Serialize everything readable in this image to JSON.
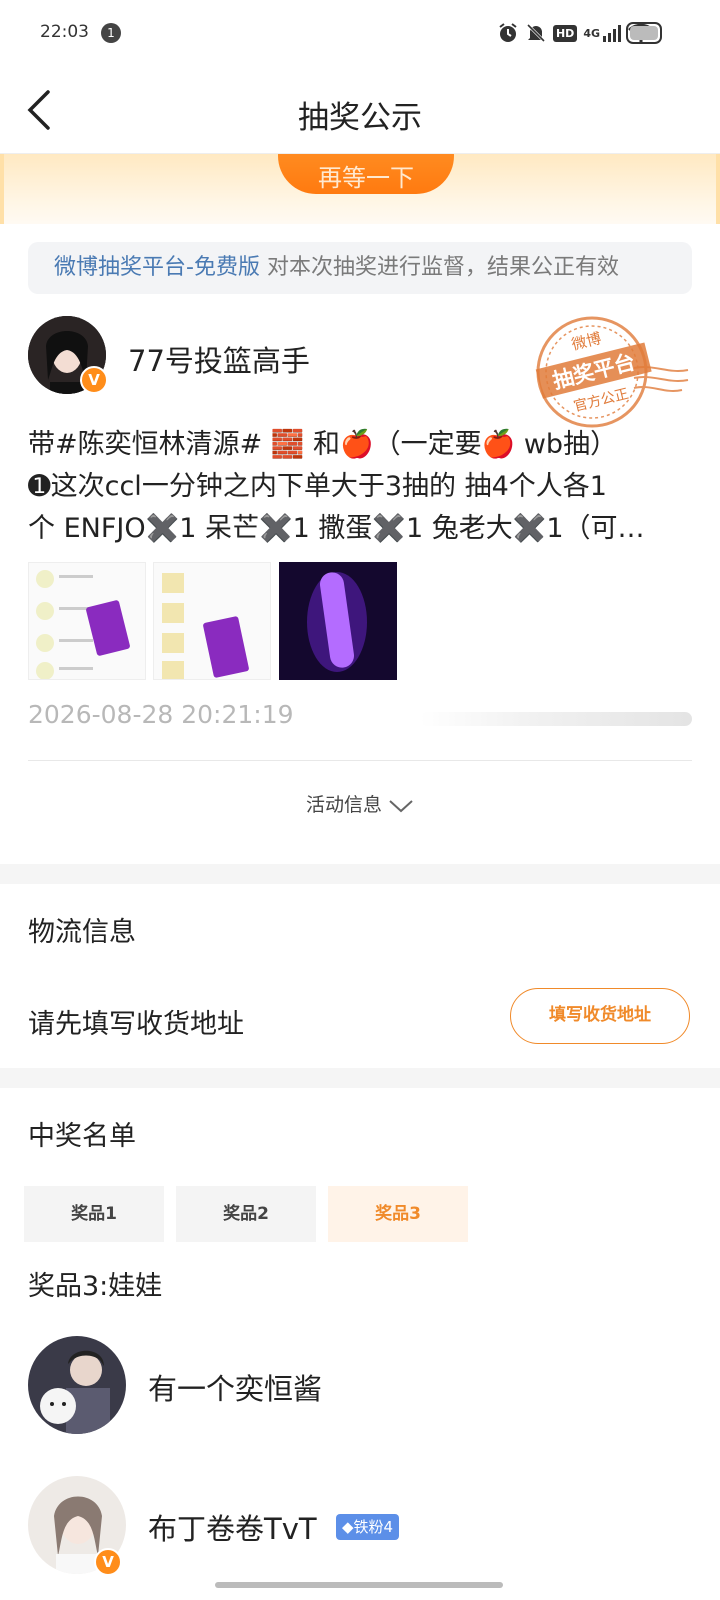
{
  "status_bar": {
    "time": "22:03",
    "notification_count": "1",
    "network": "4G",
    "hd": "HD"
  },
  "nav": {
    "title": "抽奖公示"
  },
  "banner": {
    "button_label": "再等一下"
  },
  "notice": {
    "platform_link": "微博抽奖平台-免费版",
    "text": " 对本次抽奖进行监督，结果公正有效"
  },
  "poster": {
    "name": "77号投篮高手",
    "verified": "V"
  },
  "stamp": {
    "top": "微博",
    "middle": "抽奖平台",
    "bottom": "官方公正"
  },
  "post": {
    "line1": "带#陈奕恒林清源# 🧱 和🍎（一定要🍎 wb抽）",
    "line2": "➊这次ccl一分钟之内下单大于3抽的 抽4个人各1",
    "line3": "个 ENFJO✖️1 呆芒✖️1 撒蛋✖️1 兔老大✖️1（可…",
    "timestamp": "2026-08-28 20:21:19"
  },
  "activity_info": {
    "label": "活动信息"
  },
  "logistics": {
    "title": "物流信息",
    "prompt": "请先填写收货地址",
    "button": "填写收货地址"
  },
  "winners": {
    "title": "中奖名单",
    "tabs": [
      "奖品1",
      "奖品2",
      "奖品3"
    ],
    "active_tab": 2,
    "prize_label": "奖品3:娃娃",
    "list": [
      {
        "name": "有一个奕恒酱"
      },
      {
        "name": "布丁卷卷TvT",
        "badge": "◆铁粉4"
      }
    ]
  },
  "colors": {
    "accent": "#f08a2a",
    "link": "#4a7ab3",
    "badge_orange": "#ff8d1a"
  }
}
